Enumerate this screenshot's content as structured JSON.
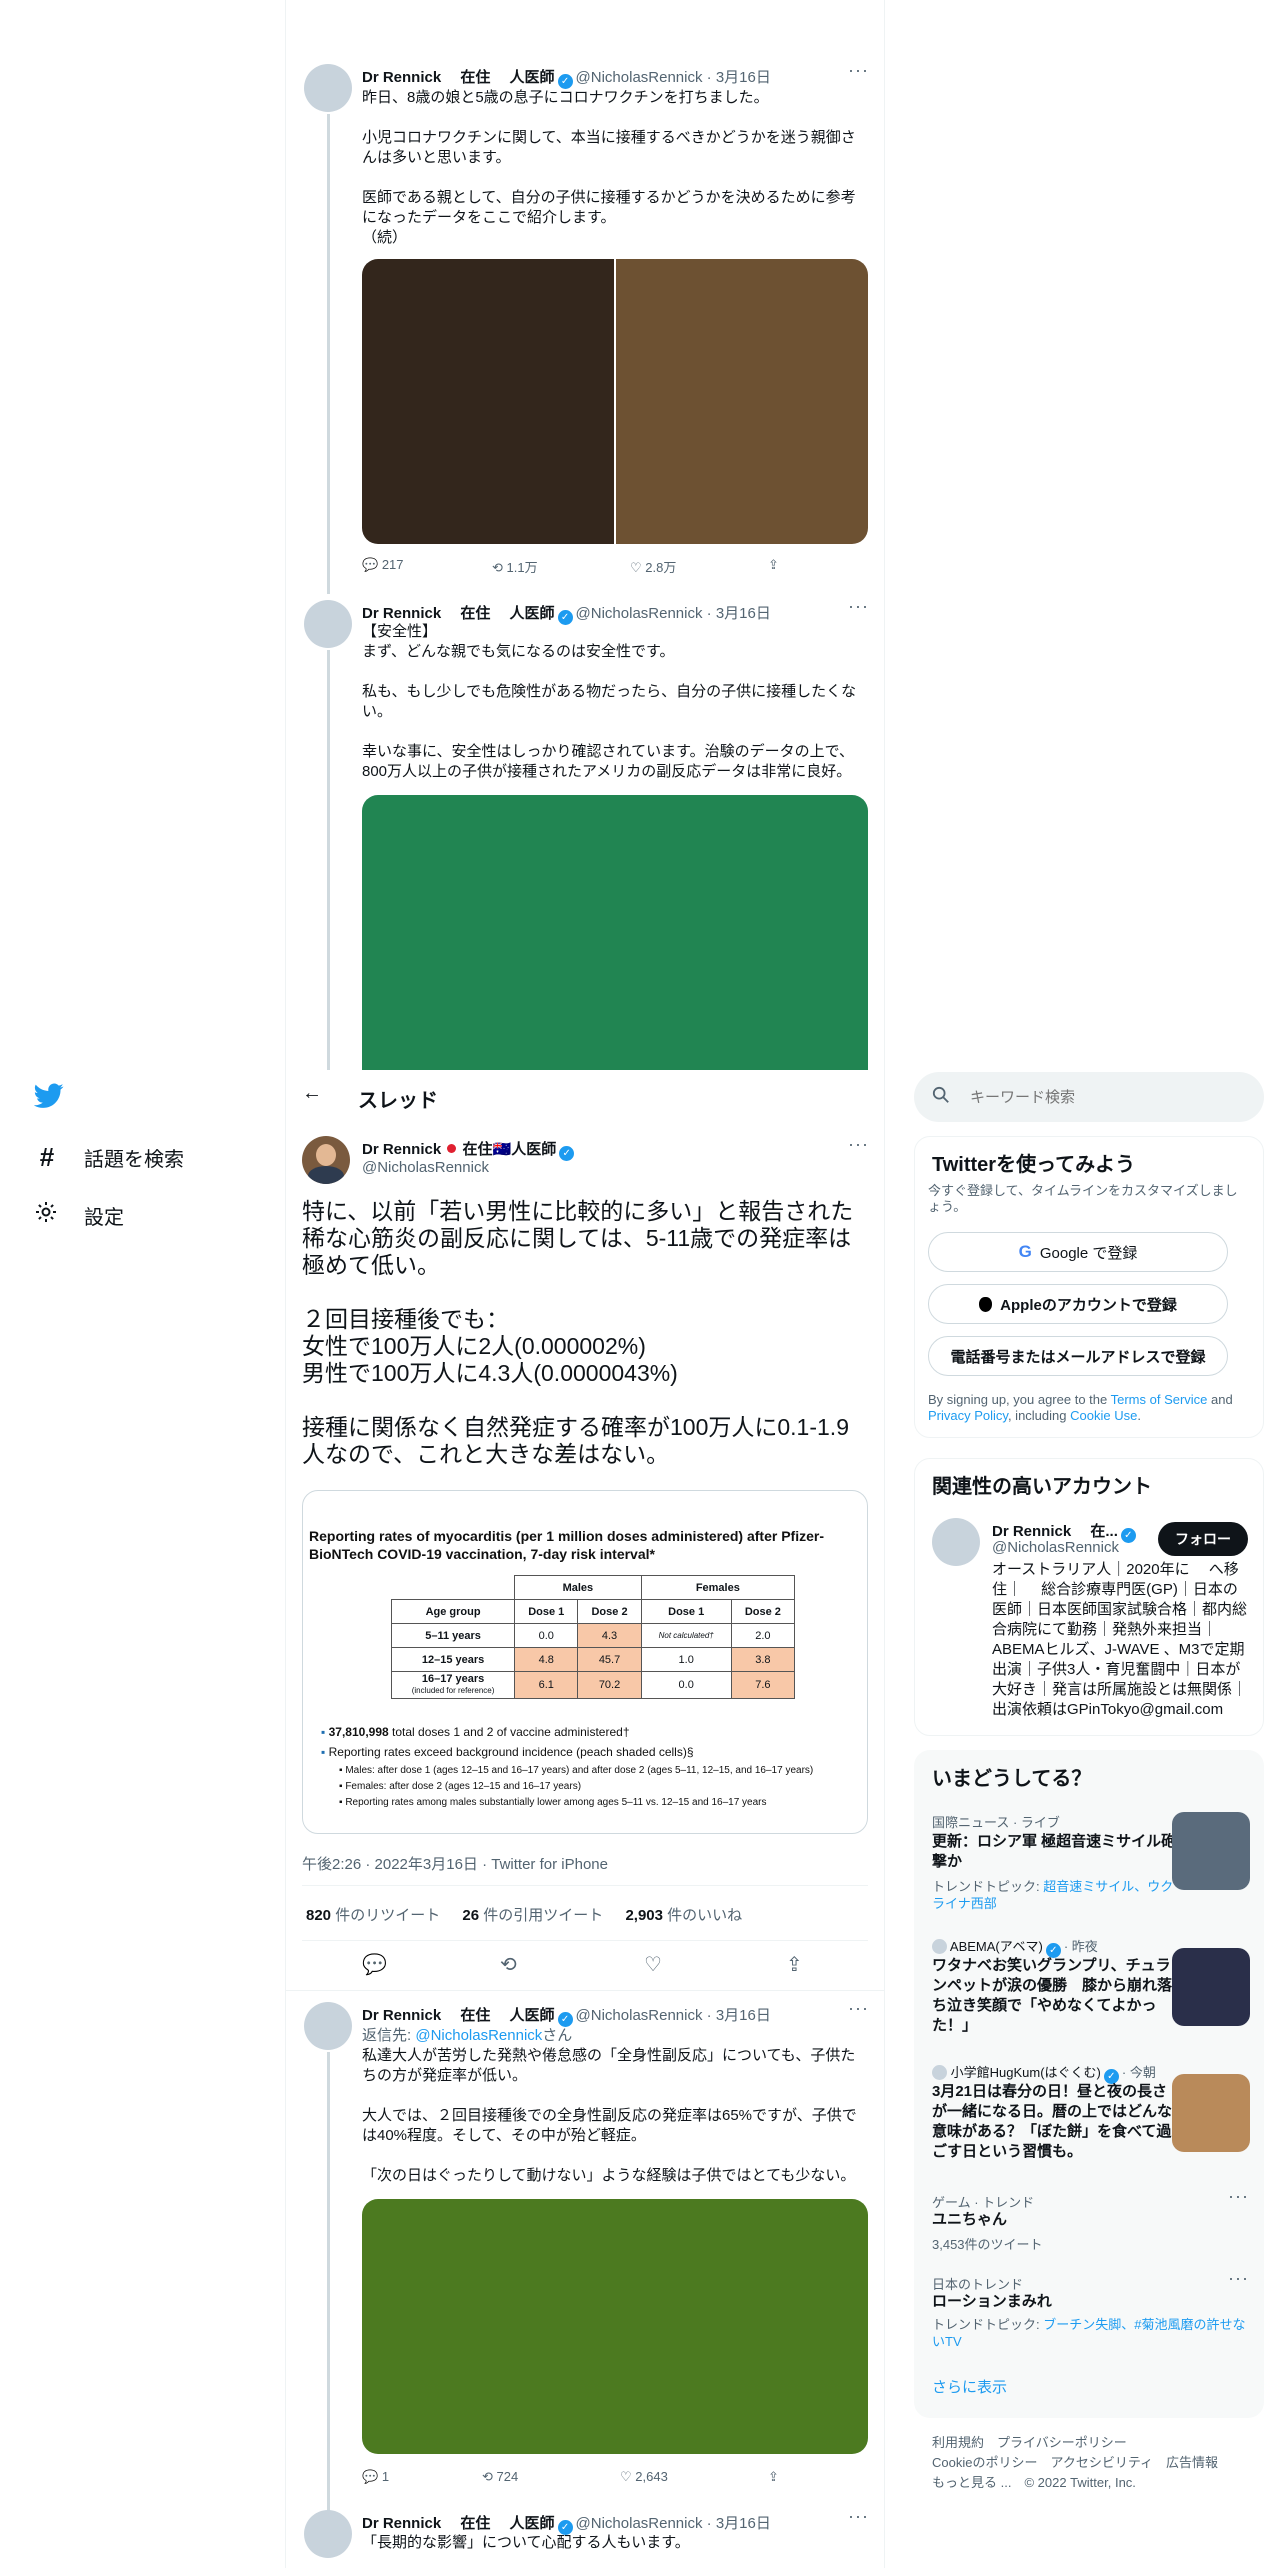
{
  "left_nav": {
    "explore_label": "話題を検索",
    "settings_label": "設定"
  },
  "header": {
    "title": "スレッド"
  },
  "tweets_above": [
    {
      "author": "Dr Rennick　 在住　 人医師",
      "handle": "@NicholasRennick",
      "date": "· 3月16日",
      "paragraphs": [
        "昨日、8歳の娘と5歳の息子にコロナワクチンを打ちました。",
        "小児コロナワクチンに関して、本当に接種するべきかどうかを迷う親御さんは多いと思います。",
        "医師である親として、自分の子供に接種するかどうかを決めるために参考になったデータをここで紹介します。\n（続）"
      ],
      "replies": "217",
      "retweets": "1.1万",
      "likes": "2.8万"
    },
    {
      "author": "Dr Rennick　 在住　 人医師",
      "handle": "@NicholasRennick",
      "date": "· 3月16日",
      "paragraphs": [
        "【安全性】\nまず、どんな親でも気になるのは安全性です。",
        "私も、もし少しでも危険性がある物だったら、自分の子供に接種したくない。",
        "幸いな事に、安全性はしっかり確認されています。治験のデータの上で、800万人以上の子供が接種されたアメリカの副反応データは非常に良好。"
      ]
    }
  ],
  "main_tweet": {
    "author": "Dr Rennick",
    "author_suffix": "在住🇦🇺人医師",
    "handle": "@NicholasRennick",
    "body": "特に、以前「若い男性に比較的に多い」と報告された稀な心筋炎の副反応に関しては、5-11歳での発症率は極めて低い。\n\n２回目接種後でも：\n女性で100万人に2人(0.000002%)\n男性で100万人に4.3人(0.0000043%)\n\n接種に関係なく自然発症する確率が100万人に0.1-1.9人なので、これと大きな差はない。",
    "image": {
      "title": "Reporting rates of myocarditis (per 1 million doses administered) after Pfizer-BioNTech COVID-19 vaccination, 7-day risk interval*",
      "group_males": "Males",
      "group_females": "Females",
      "headers": [
        "Age group",
        "Dose 1",
        "Dose 2",
        "Dose 1",
        "Dose 2"
      ],
      "rows": [
        [
          "5–11 years",
          "0.0",
          "4.3",
          "Not calculated†",
          "2.0"
        ],
        [
          "12–15 years",
          "4.8",
          "45.7",
          "1.0",
          "3.8"
        ],
        [
          "16–17 years",
          "6.1",
          "70.2",
          "0.0",
          "7.6"
        ]
      ],
      "row3_note": "(included for reference)",
      "bullet1_num": "37,810,998",
      "bullet1_rest": "total doses 1 and 2 of vaccine administered†",
      "bullet2": "Reporting rates exceed background incidence (peach shaded cells)§",
      "sub1": "Males: after dose 1 (ages 12–15 and 16–17 years) and after dose 2 (ages 5–11, 12–15, and 16–17 years)",
      "sub2": "Females: after dose 2 (ages 12–15 and 16–17 years)",
      "sub3": "Reporting rates among males substantially lower among ages 5–11 vs. 12–15 and 16–17 years"
    },
    "timestamp": "午後2:26 · 2022年3月16日 · Twitter for iPhone",
    "retweets_num": "820",
    "retweets_label": "件のリツイート",
    "quotes_num": "26",
    "quotes_label": "件の引用ツイート",
    "likes_num": "2,903",
    "likes_label": "件のいいね"
  },
  "tweets_below": [
    {
      "author": "Dr Rennick　 在住　 人医師",
      "handle": "@NicholasRennick",
      "date": "· 3月16日",
      "reply_prefix": "返信先: ",
      "reply_to": "@NicholasRennick",
      "reply_suffix": "さん",
      "paragraphs": [
        "私達大人が苦労した発熱や倦怠感の「全身性副反応」についても、子供たちの方が発症率が低い。",
        "大人では、２回目接種後での全身性副反応の発症率は65%ですが、子供では40%程度。そして、その中が殆ど軽症。",
        "「次の日はぐったりして動けない」ような経験は子供ではとても少ない。"
      ],
      "replies": "1",
      "retweets": "724",
      "likes": "2,643"
    },
    {
      "author": "Dr Rennick　 在住　 人医師",
      "handle": "@NicholasRennick",
      "date": "· 3月16日",
      "text": "「長期的な影響」について心配する人もいます。"
    }
  ],
  "search": {
    "placeholder": "キーワード検索"
  },
  "signup": {
    "title": "Twitterを使ってみよう",
    "subtitle": "今すぐ登録して、タイムラインをカスタマイズしましょう。",
    "google": "Google で登録",
    "apple": "Appleのアカウントで登録",
    "phone": "電話番号またはメールアドレスで登録",
    "legal_1": "By signing up, you agree to the ",
    "terms": "Terms of Service",
    "legal_2": " and ",
    "privacy": "Privacy Policy",
    "legal_3": ", including ",
    "cookie": "Cookie Use",
    "legal_4": "."
  },
  "related": {
    "title": "関連性の高いアカウント",
    "name": "Dr Rennick　 在...",
    "handle": "@NicholasRennick",
    "follow": "フォロー",
    "bio": "オーストラリア人｜2020年に　 へ移住｜　 総合診療専門医(GP)｜日本の医師｜日本医師国家試験合格｜都内総合病院にて勤務｜発熱外来担当｜ABEMAヒルズ、J-WAVE 、M3で定期出演｜子供3人・育児奮闘中｜日本が大好き｜発言は所属施設とは無関係｜出演依頼はGPinTokyo@gmail.com"
  },
  "trends": {
    "title": "いまどうしてる？",
    "items": [
      {
        "label": "国際ニュース · ライブ",
        "title": "更新：ロシア軍 極超音速ミサイル砲撃か",
        "topic_prefix": "トレンドトピック: ",
        "topic": "超音速ミサイル、ウクライナ西部"
      },
      {
        "label": "ABEMA(アベマ)",
        "label_suffix": "· 昨夜",
        "title": "ワタナベお笑いグランプリ、チュランペットが涙の優勝　膝から崩れ落ち泣き笑顔で「やめなくてよかった！」"
      },
      {
        "label": "小学館HugKum(はぐくむ)",
        "label_suffix": "· 今朝",
        "title": "3月21日は春分の日！昼と夜の長さが一緒になる日。暦の上ではどんな意味がある？「ぼた餅」を食べて過ごす日という習慣も。"
      },
      {
        "label": "ゲーム · トレンド",
        "title": "ユニちゃん",
        "count": "3,453件のツイート"
      },
      {
        "label": "日本のトレンド",
        "title": "ローションまみれ",
        "topic_prefix": "トレンドトピック: ",
        "topic": "ブーチン失脚、#菊池風磨の許せないTV"
      }
    ],
    "show_more": "さらに表示"
  },
  "footer": {
    "line1": "利用規約　プライバシーポリシー",
    "line2": "Cookieのポリシー　アクセシビリティ　広告情報",
    "line3": "もっと見る ...　© 2022 Twitter, Inc."
  },
  "colors": {
    "accent": "#1d9bf0",
    "text": "#0f1419",
    "muted": "#536471"
  }
}
